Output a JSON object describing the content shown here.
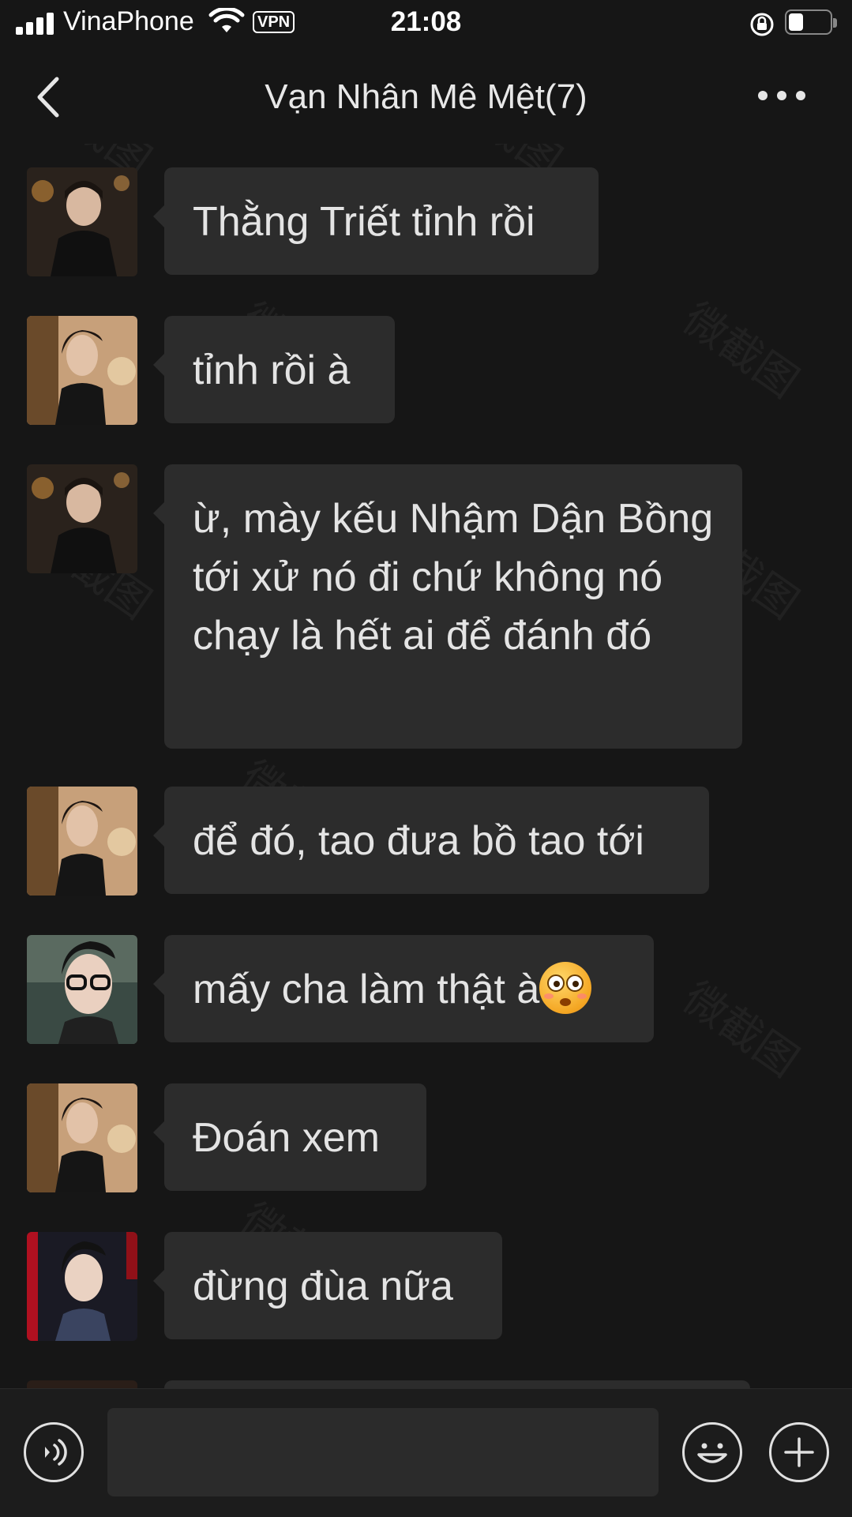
{
  "status_bar": {
    "carrier": "VinaPhone",
    "vpn": "VPN",
    "time": "21:08",
    "battery_level": 0.35
  },
  "nav": {
    "title": "Vạn Nhân Mê Mệt(7)"
  },
  "messages": [
    {
      "text": "Thằng Triết tỉnh rồi",
      "avatar": "avatar-1"
    },
    {
      "text": "tỉnh rồi à",
      "avatar": "avatar-2"
    },
    {
      "text": "ừ, mày kếu Nhậm Dận Bồng tới xử nó đi chứ không nó chạy là hết ai để đánh đó",
      "avatar": "avatar-1"
    },
    {
      "text": "để đó, tao đưa bồ tao tới",
      "avatar": "avatar-2"
    },
    {
      "text": "mấy cha làm thật à",
      "avatar": "avatar-3",
      "emoji": "flushed-face-emoji"
    },
    {
      "text": "Đoán xem",
      "avatar": "avatar-2"
    },
    {
      "text": "đừng đùa nữa",
      "avatar": "avatar-4"
    }
  ],
  "watermark": "微截图",
  "icons": {
    "back": "chevron-left-icon",
    "more": "more-dots-icon",
    "voice": "voice-icon",
    "emoji": "emoji-icon",
    "plus": "plus-icon"
  }
}
